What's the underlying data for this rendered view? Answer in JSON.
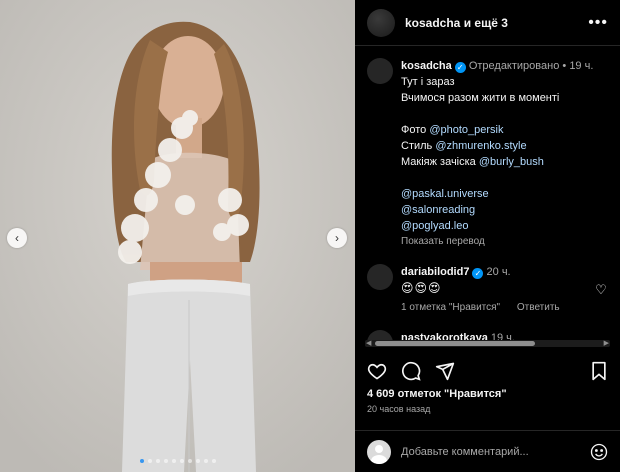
{
  "media": {
    "prev_icon": "chevron-left-icon",
    "next_icon": "chevron-right-icon",
    "carousel_count": 10,
    "active_index": 0
  },
  "header": {
    "title": "kosadcha и ещё 3",
    "more_icon": "more-horizontal-icon"
  },
  "caption": {
    "username": "kosadcha",
    "edited": "Отредактировано",
    "separator": "•",
    "time": "19 ч.",
    "lines": [
      "Тут і зараз",
      "Вчимося разом жити в моменті",
      "",
      "Фото",
      "Стиль",
      "Макіяж зачіска"
    ],
    "mentions": {
      "photo": "@photo_persik",
      "style": "@zhmurenko.style",
      "makeup": "@burly_bush"
    },
    "tags": [
      "@paskal.universe",
      "@salonreading",
      "@poglyad.leo"
    ],
    "translate": "Показать перевод"
  },
  "comments": [
    {
      "username": "dariabilodid7",
      "time": "20 ч.",
      "text": "😍😍😍",
      "likes": "1 отметка \"Нравится\"",
      "reply": "Ответить"
    },
    {
      "username": "nastyakorotkaya",
      "time": "19 ч.",
      "text": "😍"
    }
  ],
  "actions": {
    "like": "heart-icon",
    "comment": "comment-icon",
    "share": "share-icon",
    "save": "bookmark-icon"
  },
  "likes": "4 609 отметок \"Нравится\"",
  "posted": "20 часов назад",
  "compose": {
    "placeholder": "Добавьте комментарий..."
  },
  "colors": {
    "background": "#000000",
    "text": "#f5f5f5",
    "muted": "#a8a8a8",
    "link": "#b3dbff",
    "verified": "#0095f6",
    "photo_backdrop": "#c9c6c1"
  }
}
